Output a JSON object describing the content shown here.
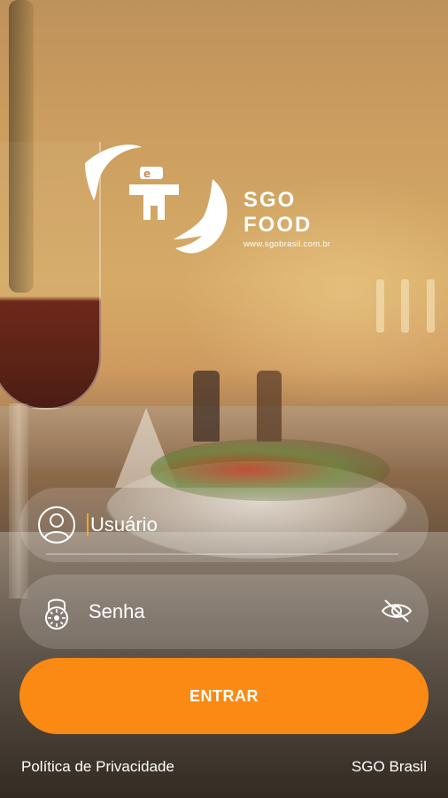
{
  "brand": {
    "name": "SGO FOOD",
    "url": "www.sgobrasil.com.br"
  },
  "form": {
    "username_placeholder": "Usuário",
    "password_placeholder": "Senha",
    "submit_label": "ENTRAR"
  },
  "footer": {
    "privacy_link": "Política de Privacidade",
    "company_link": "SGO Brasil"
  },
  "icons": {
    "user": "user-circle-icon",
    "lock": "padlock-icon",
    "visibility": "eye-off-icon"
  },
  "colors": {
    "accent": "#fa8a13",
    "cursor": "#f5a623",
    "text": "#ffffff"
  }
}
